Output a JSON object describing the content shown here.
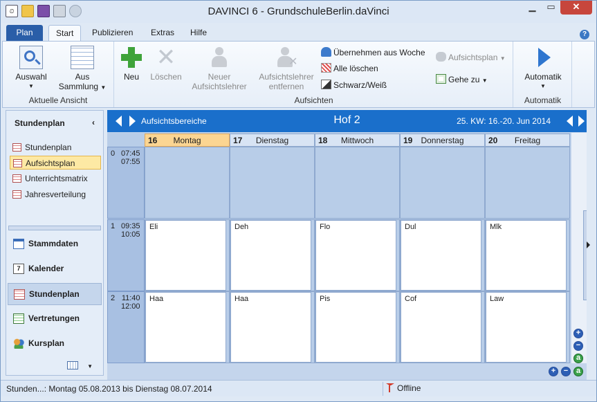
{
  "window": {
    "title": "DAVINCI 6 - GrundschuleBerlin.daVinci"
  },
  "quick_access": [
    "app-icon",
    "open-folder-icon",
    "save-icon",
    "print-icon",
    "refresh-icon"
  ],
  "ribbon_tabs": {
    "plan": "Plan",
    "start": "Start",
    "publizieren": "Publizieren",
    "extras": "Extras",
    "hilfe": "Hilfe"
  },
  "groups": {
    "aktuelle_ansicht": {
      "label": "Aktuelle Ansicht",
      "auswahl": "Auswahl",
      "aus": "Aus",
      "sammlung": "Sammlung"
    },
    "aufsichten": {
      "label": "Aufsichten",
      "neu": "Neu",
      "loeschen": "Löschen",
      "neuer_l1": "Neuer",
      "neuer_l2": "Aufsichtslehrer",
      "entfernen_l1": "Aufsichtslehrer",
      "entfernen_l2": "entfernen",
      "uebernehmen": "Übernehmen aus Woche",
      "alle_loeschen": "Alle löschen",
      "schwarz_weiss": "Schwarz/Weiß",
      "aufsichtsplan": "Aufsichtsplan",
      "gehe_zu": "Gehe zu"
    },
    "automatik": {
      "label": "Automatik",
      "button": "Automatik"
    }
  },
  "sidebar": {
    "title": "Stundenplan",
    "items": [
      "Stundenplan",
      "Aufsichtsplan",
      "Unterrichtsmatrix",
      "Jahresverteilung"
    ],
    "selected_item": "Aufsichtsplan",
    "nav": [
      "Stammdaten",
      "Kalender",
      "Stundenplan",
      "Vertretungen",
      "Kursplan"
    ],
    "selected_nav": "Stundenplan"
  },
  "header": {
    "bereich": "Aufsichtsbereiche",
    "title": "Hof 2",
    "week": "25. KW: 16.-20. Jun 2014"
  },
  "days": [
    {
      "num": "16",
      "name": "Montag",
      "today": true
    },
    {
      "num": "17",
      "name": "Dienstag"
    },
    {
      "num": "18",
      "name": "Mittwoch"
    },
    {
      "num": "19",
      "name": "Donnerstag"
    },
    {
      "num": "20",
      "name": "Freitag"
    }
  ],
  "slots": [
    {
      "idx": "0",
      "start": "07:45",
      "end": "07:55",
      "entries": [
        "",
        "",
        "",
        "",
        ""
      ]
    },
    {
      "idx": "1",
      "start": "09:35",
      "end": "10:05",
      "entries": [
        "Eli",
        "Deh",
        "Flo",
        "Dul",
        "Mlk"
      ]
    },
    {
      "idx": "2",
      "start": "11:40",
      "end": "12:00",
      "entries": [
        "Haa",
        "Haa",
        "Pis",
        "Cof",
        "Law"
      ]
    }
  ],
  "zoom_labels": {
    "plus": "+",
    "minus": "−",
    "a": "a"
  },
  "status": {
    "left": "Stunden...: Montag 05.08.2013 bis Dienstag 08.07.2014",
    "right": "Offline"
  }
}
